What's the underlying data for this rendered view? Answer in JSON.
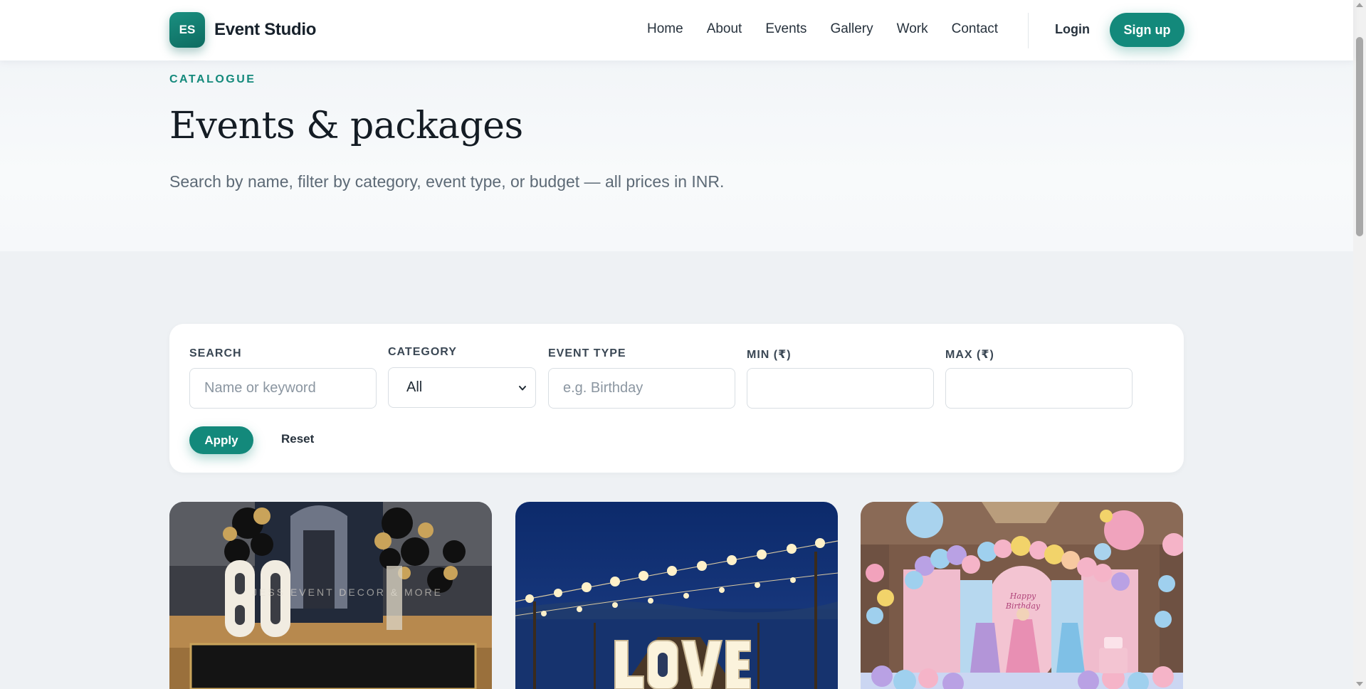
{
  "brand": {
    "badge": "ES",
    "name": "Event Studio"
  },
  "nav": {
    "items": [
      "Home",
      "About",
      "Events",
      "Gallery",
      "Work",
      "Contact"
    ],
    "login": "Login",
    "signup": "Sign up"
  },
  "hero": {
    "eyebrow": "CATALOGUE",
    "title": "Events & packages",
    "subtitle": "Search by name, filter by category, event type, or budget — all prices in INR."
  },
  "filters": {
    "search_label": "SEARCH",
    "search_placeholder": "Name or keyword",
    "category_label": "CATEGORY",
    "category_value": "All",
    "event_type_label": "EVENT TYPE",
    "event_type_placeholder": "e.g. Birthday",
    "min_label": "MIN (₹)",
    "min_value": "",
    "max_label": "MAX (₹)",
    "max_value": "",
    "apply": "Apply",
    "reset": "Reset"
  },
  "cards": [
    {
      "image": "60th birthday decor with marquee 60 letters and black-gold balloons",
      "watermark": "JESS EVENT DECOR & MORE"
    },
    {
      "image": "LOVE marquee letters with string lights at night by the sea"
    },
    {
      "image": "princess themed birthday backdrop with pastel balloon arch",
      "sign_line1": "Happy",
      "sign_line2": "Birthday"
    }
  ],
  "colors": {
    "accent": "#13897b",
    "background": "#eef1f4"
  }
}
